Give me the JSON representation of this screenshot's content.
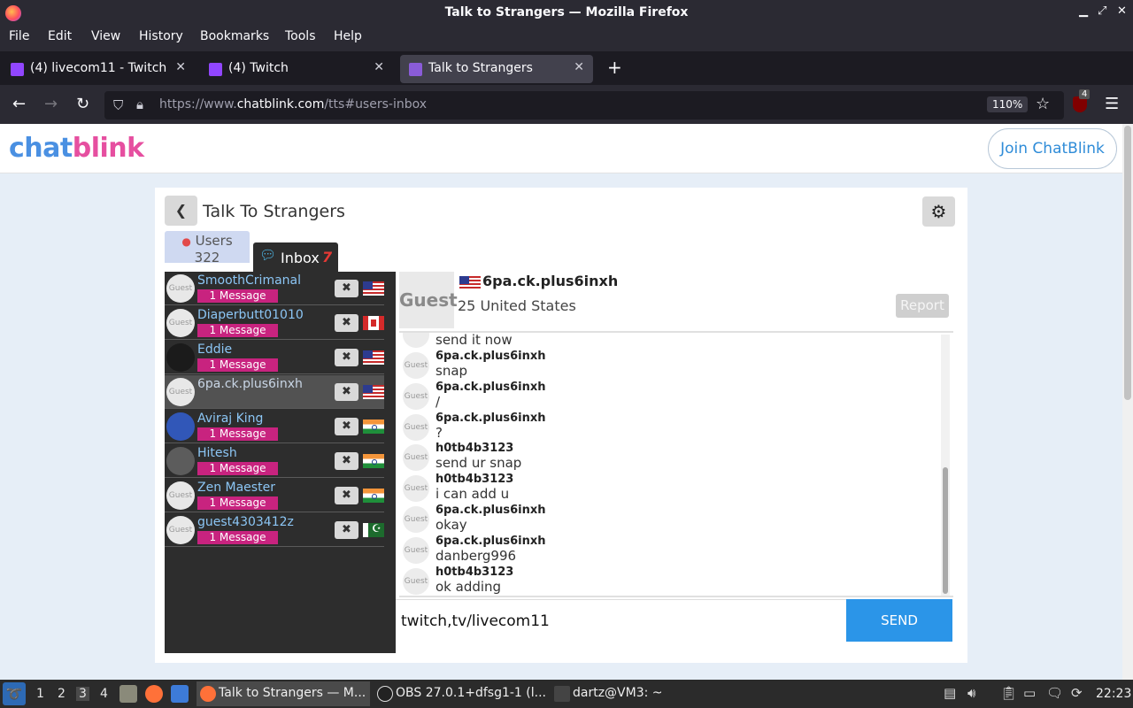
{
  "window": {
    "title": "Talk to Strangers — Mozilla Firefox"
  },
  "menubar": [
    "File",
    "Edit",
    "View",
    "History",
    "Bookmarks",
    "Tools",
    "Help"
  ],
  "tabs": [
    {
      "label": "(4) livecom11 - Twitch",
      "icon": "twitch-icon",
      "active": false
    },
    {
      "label": "(4) Twitch",
      "icon": "twitch-icon",
      "active": false
    },
    {
      "label": "Talk to Strangers",
      "icon": "chatblink-icon",
      "active": true
    }
  ],
  "navbar": {
    "url_prefix": "https://www.",
    "url_domain": "chatblink.com",
    "url_path": "/tts#users-inbox",
    "zoom": "110%",
    "ublock_badge": "4"
  },
  "site": {
    "logo_part1": "chat",
    "logo_part2": "blink",
    "join_label": "Join ChatBlink",
    "colors": {
      "chat": "#4a90e2",
      "blink": "#e64fa0",
      "accent": "#2b95e8"
    }
  },
  "card": {
    "title": "Talk To Strangers",
    "users_tab_label": "Users",
    "users_count": "322",
    "inbox_tab_label": "Inbox",
    "inbox_count": "7"
  },
  "users": [
    {
      "name": "SmoothCrimanal",
      "badge": "1 Message",
      "flag": "us",
      "avatar": "Guest",
      "selected": false
    },
    {
      "name": "Diaperbutt01010",
      "badge": "1 Message",
      "flag": "ca",
      "avatar": "Guest",
      "selected": false
    },
    {
      "name": "Eddie",
      "badge": "1 Message",
      "flag": "us",
      "avatar": "",
      "selected": false
    },
    {
      "name": "6pa.ck.plus6inxh",
      "badge": "",
      "flag": "us",
      "avatar": "Guest",
      "selected": true
    },
    {
      "name": "Aviraj King",
      "badge": "1 Message",
      "flag": "in",
      "avatar": "",
      "selected": false
    },
    {
      "name": "Hitesh",
      "badge": "1 Message",
      "flag": "in",
      "avatar": "",
      "selected": false
    },
    {
      "name": "Zen Maester",
      "badge": "1 Message",
      "flag": "in",
      "avatar": "Guest",
      "selected": false
    },
    {
      "name": "guest4303412z",
      "badge": "1 Message",
      "flag": "pk",
      "avatar": "Guest",
      "selected": false
    }
  ],
  "chat": {
    "partner_avatar": "Guest",
    "partner_name": "6pa.ck.plus6inxh",
    "partner_info": "25 United States",
    "report_label": "Report",
    "messages": [
      {
        "user": "",
        "text": "send it now",
        "avatar": ""
      },
      {
        "user": "6pa.ck.plus6inxh",
        "text": "snap",
        "avatar": "Guest"
      },
      {
        "user": "6pa.ck.plus6inxh",
        "text": "/",
        "avatar": "Guest"
      },
      {
        "user": "6pa.ck.plus6inxh",
        "text": "?",
        "avatar": "Guest"
      },
      {
        "user": "h0tb4b3123",
        "text": "send ur snap",
        "avatar": "Guest"
      },
      {
        "user": "h0tb4b3123",
        "text": "i can add u",
        "avatar": "Guest"
      },
      {
        "user": "6pa.ck.plus6inxh",
        "text": "okay",
        "avatar": "Guest"
      },
      {
        "user": "6pa.ck.plus6inxh",
        "text": "danberg996",
        "avatar": "Guest"
      },
      {
        "user": "h0tb4b3123",
        "text": "ok adding",
        "avatar": "Guest"
      }
    ],
    "input_value": "twitch,tv/livecom11",
    "send_label": "SEND"
  },
  "taskbar": {
    "workspaces": [
      "1",
      "2",
      "3",
      "4"
    ],
    "active_workspace": "3",
    "tasks": [
      {
        "label": "Talk to Strangers — M...",
        "active": true
      },
      {
        "label": "OBS 27.0.1+dfsg1-1 (l...",
        "active": false
      },
      {
        "label": "dartz@VM3: ~",
        "active": false
      }
    ],
    "clock": "22:23"
  }
}
